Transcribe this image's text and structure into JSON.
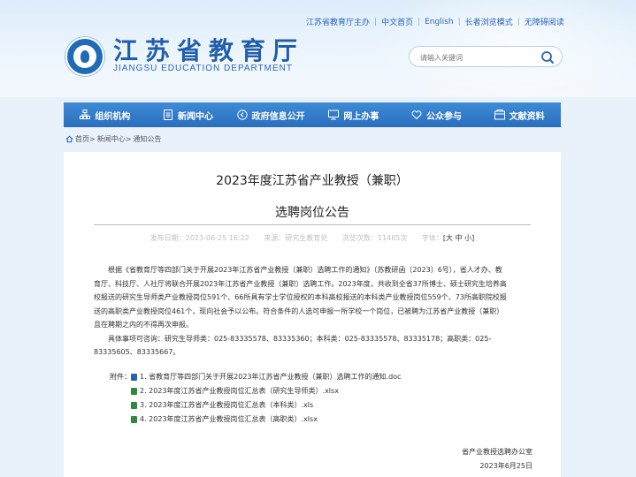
{
  "topbar": {
    "host": "江苏省教育厅主办",
    "cn_home": "中文首页",
    "english": "English",
    "elder_mode": "长者浏览模式",
    "accessibility": "无障碍阅读"
  },
  "logo": {
    "title": "江苏省教育厅",
    "subtitle": "JIANGSU EDUCATION DEPARTMENT"
  },
  "search": {
    "placeholder": "请输入关键词"
  },
  "nav": {
    "items": [
      {
        "label": "组织机构",
        "icon": "org-chart-icon"
      },
      {
        "label": "新闻中心",
        "icon": "news-icon"
      },
      {
        "label": "政府信息公开",
        "icon": "info-disclosure-icon"
      },
      {
        "label": "网上办事",
        "icon": "online-service-icon"
      },
      {
        "label": "公众参与",
        "icon": "heart-icon"
      },
      {
        "label": "文献资料",
        "icon": "documents-icon"
      }
    ]
  },
  "breadcrumb": {
    "home": "首页",
    "sep1": ">",
    "news": "新闻中心",
    "sep2": ">",
    "notice": "通知公告"
  },
  "article": {
    "title_line1": "2023年度江苏省产业教授（兼职）",
    "title_line2": "选聘岗位公告",
    "publish_date": "发布日期：2023-06-25 16:22",
    "source": "来源：研究生教育处",
    "views": "浏览次数：11485次",
    "font_label": "字体：",
    "font_options": "[大 中 小]",
    "paragraph1_l1": "根据《省教育厅等四部门关于开展2023年江苏省产业教授（兼职）选聘工作的通知》（苏教研函〔2023〕6号），省人才办、教",
    "paragraph1_l2": "育厅、科技厅、人社厅将联合开展2023年江苏省产业教授（兼职）选聘工作。2023年度，共收到全省37所博士、硕士研究生培养高",
    "paragraph1_l3": "校报送的研究生导师类产业教授岗位591个、66所具有学士学位授权的本科高校报送的本科类产业教授岗位559个、73所高职院校报",
    "paragraph1_l4": "送的高职类产业教授岗位461个，现向社会予以公布。符合条件的人选可申报一所学校一个岗位，已被聘为江苏省产业教授（兼职）",
    "paragraph1_l5": "且在聘期之内的不得再次申报。",
    "paragraph2_l1": "具体事项可咨询：研究生导师类：025-83335578、83335360；本科类：025-83335578、83335178；高职类：025-",
    "paragraph2_l2": "83335605、83335667。",
    "attach_label": "附件：",
    "attachments": [
      {
        "label": "1. 省教育厅等四部门关于开展2023年江苏省产业教授（兼职）选聘工作的通知.doc",
        "color": "#2b5fb3"
      },
      {
        "label": "2. 2023年度江苏省产业教授岗位汇总表（研究生导师类）.xlsx",
        "color": "#2e8b3d"
      },
      {
        "label": "3. 2023年度江苏省产业教授岗位汇总表（本科类）.xls",
        "color": "#2e8b3d"
      },
      {
        "label": "4. 2023年度江苏省产业教授岗位汇总表（高职类）.xlsx",
        "color": "#2e8b3d"
      }
    ],
    "signature": "省产业教授选聘办公室",
    "sign_date": "2023年6月25日"
  },
  "colors": {
    "nav_bg": "#2a6fbd",
    "brand": "#1f5fae",
    "page_bg": "#e9f2fb"
  }
}
